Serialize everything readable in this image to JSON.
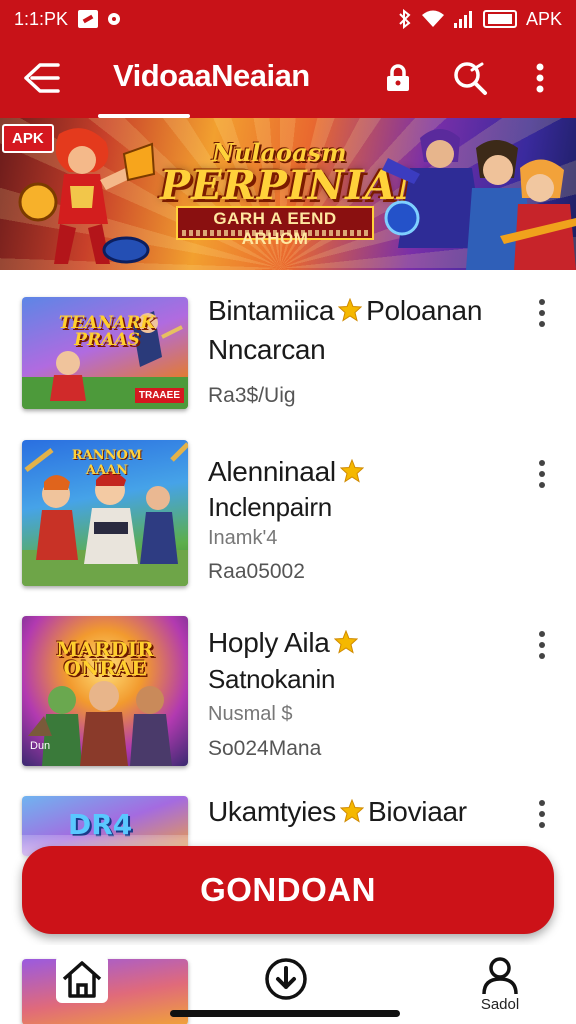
{
  "status_bar": {
    "time": "1:1:PK",
    "battery_text": "",
    "right_text": "APK"
  },
  "app_bar": {
    "title": "VidoaaNeaian",
    "icons": [
      "menu-icon",
      "lock-icon",
      "search-icon",
      "more-vert-icon"
    ]
  },
  "banner": {
    "badge": "APK",
    "title_top": "Nulaoasm",
    "title_main": "PERPINIAN",
    "subtitle": "GARH A EEND ARHOM",
    "dots": 5,
    "active_dot": 1
  },
  "apps": [
    {
      "title": "Bintamiica",
      "title_after_star": "Poloanan",
      "subtitle": "Nncarcan",
      "caption": "",
      "meta": "Ra3$/Uig",
      "thumb_text": "TEANARK PRAAS",
      "thumb_badge": "TRAAEE"
    },
    {
      "title": "Alenninaal",
      "title_after_star": "",
      "subtitle": "Inclenpairn",
      "caption": "Inamk'4",
      "meta": "Raa05002",
      "thumb_text": "RANNOM AAAN",
      "thumb_badge": ""
    },
    {
      "title": "Hoply Aila",
      "title_after_star": "",
      "subtitle": "Satnokanin",
      "caption": "Nusmal $",
      "meta": "So024Mana",
      "thumb_text": "MARDIR ONRAE",
      "thumb_badge": "Dun"
    },
    {
      "title": "Ukamtyies",
      "title_after_star": "Bioviaar",
      "subtitle": "",
      "caption": "",
      "meta": "",
      "thumb_text": "DR4",
      "thumb_badge": ""
    }
  ],
  "cta": {
    "label": "GONDOAN"
  },
  "bottom_nav": {
    "items": [
      {
        "label": "",
        "icon": "home-icon"
      },
      {
        "label": "",
        "icon": "download-icon"
      },
      {
        "label": "Sadol",
        "icon": "profile-icon"
      }
    ]
  },
  "colors": {
    "primary": "#c81218",
    "star": "#f5b800"
  }
}
